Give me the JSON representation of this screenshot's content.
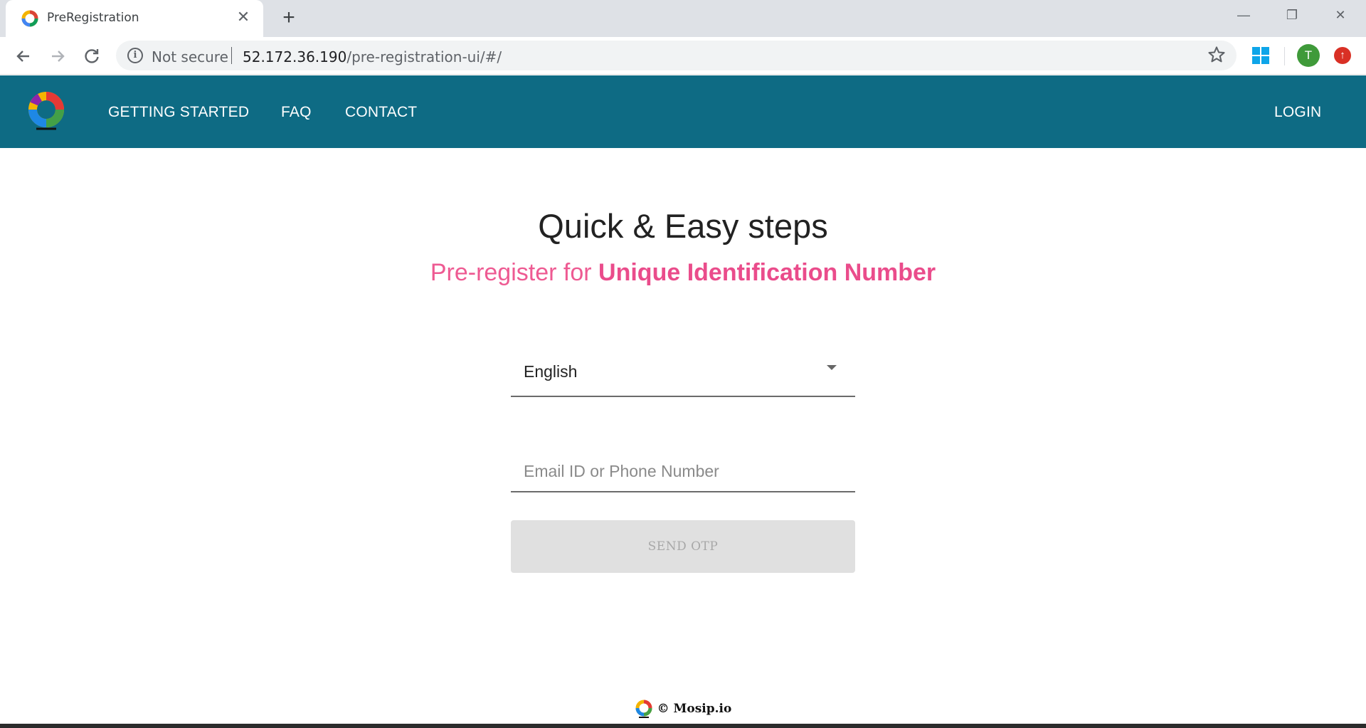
{
  "browser": {
    "tab_title": "PreRegistration",
    "tab_close": "✕",
    "new_tab": "+",
    "security_label": "Not secure",
    "url_host": "52.172.36.190",
    "url_path": "/pre-registration-ui/#/",
    "avatar_letter": "T",
    "window_controls": {
      "minimize": "—",
      "restore": "❐",
      "close": "✕"
    }
  },
  "navbar": {
    "links": [
      "GETTING STARTED",
      "FAQ",
      "CONTACT"
    ],
    "login": "LOGIN",
    "brand_color": "#0e6b84"
  },
  "hero": {
    "title": "Quick & Easy steps",
    "subtitle_prefix": "Pre-register for ",
    "subtitle_emphasis": "Unique Identification Number",
    "accent_color": "#ea4c8b"
  },
  "form": {
    "language_selected": "English",
    "contact_placeholder": "Email ID or Phone Number",
    "contact_value": "",
    "send_otp_label": "SEND OTP"
  },
  "footer": {
    "copyright": "© Mosip.io"
  },
  "icons": {
    "back": "arrow-left-icon",
    "forward": "arrow-right-icon",
    "reload": "reload-icon",
    "info": "info-icon",
    "bookmark": "star-icon",
    "extension": "windows-icon",
    "update": "update-arrow-icon",
    "dropdown": "caret-down-icon"
  }
}
